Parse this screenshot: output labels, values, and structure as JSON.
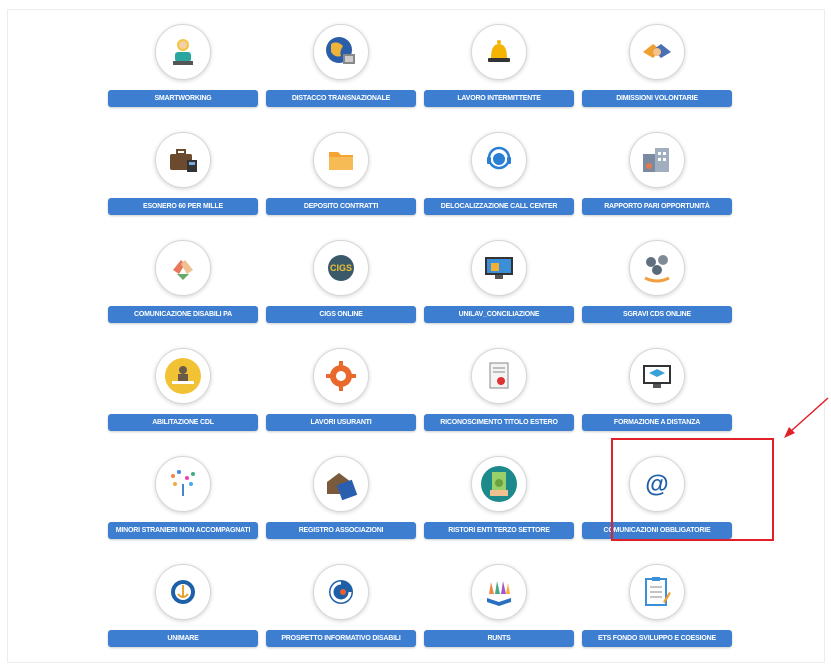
{
  "services": [
    {
      "label": "SMARTWORKING",
      "icon": "smartworking-icon"
    },
    {
      "label": "DISTACCO TRANSNAZIONALE",
      "icon": "globe-icon"
    },
    {
      "label": "LAVORO INTERMITTENTE",
      "icon": "bell-icon"
    },
    {
      "label": "DIMISSIONI VOLONTARIE",
      "icon": "handshake-icon"
    },
    {
      "label": "ESONERO 60 PER MILLE",
      "icon": "briefcase-icon"
    },
    {
      "label": "DEPOSITO CONTRATTI",
      "icon": "folder-icon"
    },
    {
      "label": "DELOCALIZZAZIONE CALL CENTER",
      "icon": "call-center-icon"
    },
    {
      "label": "RAPPORTO PARI OPPORTUNITÀ",
      "icon": "buildings-icon"
    },
    {
      "label": "COMUNICAZIONE DISABILI PA",
      "icon": "hands-icon"
    },
    {
      "label": "CIGS ONLINE",
      "icon": "cigs-icon"
    },
    {
      "label": "UNILAV_CONCILIAZIONE",
      "icon": "monitor-icon"
    },
    {
      "label": "SGRAVI CDS ONLINE",
      "icon": "coins-icon"
    },
    {
      "label": "ABILITAZIONE CDL",
      "icon": "desk-icon"
    },
    {
      "label": "LAVORI USURANTI",
      "icon": "gear-icon"
    },
    {
      "label": "RICONOSCIMENTO TITOLO ESTERO",
      "icon": "certificate-icon"
    },
    {
      "label": "FORMAZIONE A DISTANZA",
      "icon": "graduation-icon"
    },
    {
      "label": "MINORI STRANIERI NON ACCOMPAGNATI",
      "icon": "confetti-icon"
    },
    {
      "label": "REGISTRO ASSOCIAZIONI",
      "icon": "house-book-icon"
    },
    {
      "label": "RISTORI ENTI TERZO SETTORE",
      "icon": "money-icon"
    },
    {
      "label": "COMUNICAZIONI OBBLIGATORIE",
      "icon": "at-sign-icon"
    },
    {
      "label": "UNIMARE",
      "icon": "anchor-icon"
    },
    {
      "label": "PROSPETTO INFORMATIVO DISABILI",
      "icon": "swirl-icon"
    },
    {
      "label": "RUNTS",
      "icon": "book-hands-icon"
    },
    {
      "label": "ETS FONDO SVILUPPO E COESIONE",
      "icon": "checklist-icon"
    }
  ],
  "highlight_color": "#e2202a",
  "button_color": "#3d7ed1"
}
